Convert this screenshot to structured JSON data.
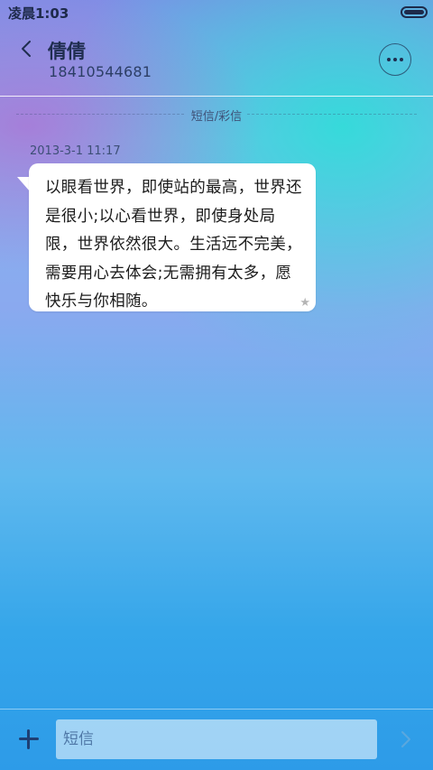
{
  "status_bar": {
    "time": "凌晨1:03",
    "battery_level_percent": 100
  },
  "header": {
    "back_icon": "chevron-left-icon",
    "contact_name": "倩倩",
    "contact_number": "18410544681",
    "more_icon": "more-horizontal-icon"
  },
  "thread": {
    "type_label": "短信/彩信",
    "messages": [
      {
        "timestamp": "2013-3-1 11:17",
        "text": "以眼看世界，即使站的最高，世界还是很小;以心看世界，即使身处局限，世界依然很大。生活远不完美，需要用心去体会;无需拥有太多，愿快乐与你相随。",
        "star_icon": "star-icon"
      }
    ]
  },
  "input_bar": {
    "add_icon": "plus-icon",
    "placeholder": "短信",
    "value": "",
    "send_icon": "chevron-right-icon"
  },
  "colors": {
    "text_dark": "#1f2d4f",
    "bubble_bg": "#ffffff",
    "bottom_bg": "#2d9be8"
  }
}
